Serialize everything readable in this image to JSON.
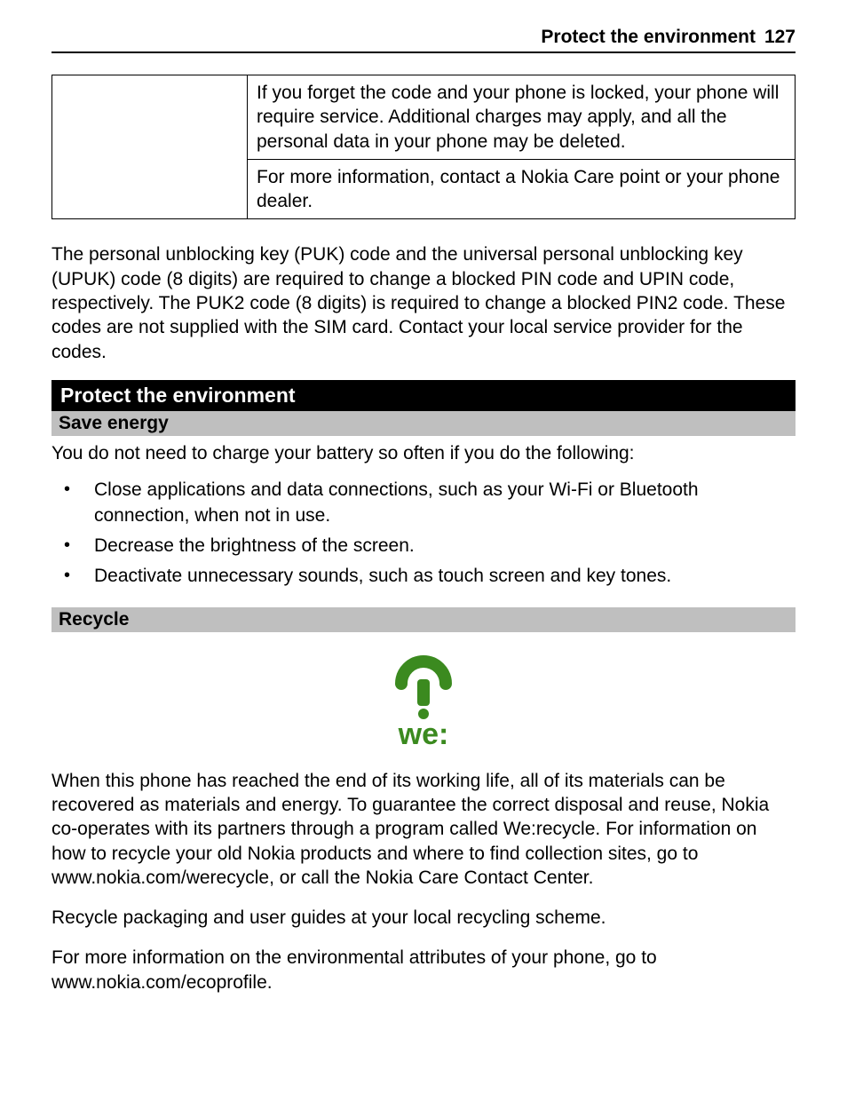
{
  "header": {
    "title": "Protect the environment",
    "page": "127"
  },
  "codeTable": {
    "cell1": "If you forget the code and your phone is locked, your phone will require service. Additional charges may apply, and all the personal data in your phone may be deleted.",
    "cell2": "For more information, contact a Nokia Care point or your phone dealer."
  },
  "pukPara": "The personal unblocking key (PUK) code and the universal personal unblocking key (UPUK) code (8 digits) are required to change a blocked PIN code and UPIN code, respectively. The PUK2 code (8 digits) is required to change a blocked PIN2 code. These codes are not supplied with the SIM card. Contact your local service provider for the codes.",
  "sections": {
    "protect": "Protect the environment",
    "saveEnergy": "Save energy",
    "recycle": "Recycle"
  },
  "saveEnergyIntro": "You do not need to charge your battery so often if you do the following:",
  "tips": [
    "Close applications and data connections, such as your Wi-Fi or Bluetooth connection, when not in use.",
    "Decrease the brightness of the screen.",
    "Deactivate unnecessary sounds, such as touch screen and key tones."
  ],
  "logoText": "we:",
  "recyclePara1": "When this phone has reached the end of its working life, all of its materials can be recovered as materials and energy. To guarantee the correct disposal and reuse, Nokia co-operates with its partners through a program called We:recycle. For information on how to recycle your old Nokia products and where to find collection sites, go to www.nokia.com/werecycle, or call the Nokia Care Contact Center.",
  "recyclePara2": "Recycle packaging and user guides at your local recycling scheme.",
  "recyclePara3": "For more information on the environmental attributes of your phone, go to www.nokia.com/ecoprofile."
}
